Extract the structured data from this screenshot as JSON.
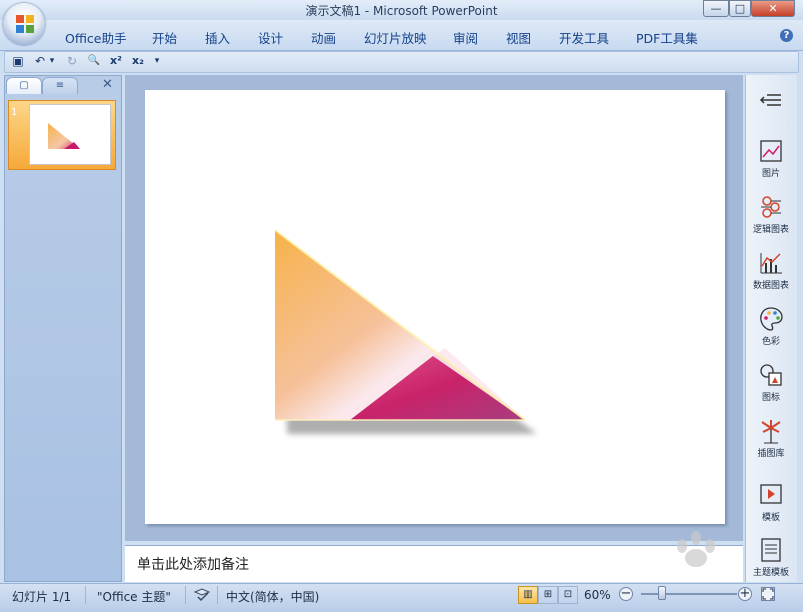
{
  "window": {
    "title": "演示文稿1 - Microsoft PowerPoint",
    "minimize": "—",
    "maximize": "□",
    "close": "✕"
  },
  "office_button": {
    "icon": "office-logo-icon"
  },
  "menu": {
    "items": [
      "Office助手",
      "开始",
      "插入",
      "设计",
      "动画",
      "幻灯片放映",
      "审阅",
      "视图",
      "开发工具",
      "PDF工具集"
    ],
    "help": "?"
  },
  "quick_access": {
    "items": [
      {
        "icon": "save-icon",
        "glyph": "▣"
      },
      {
        "icon": "undo-icon",
        "glyph": "↶"
      },
      {
        "icon": "undo-dropdown-icon",
        "glyph": "▾"
      },
      {
        "icon": "redo-icon",
        "glyph": "↻"
      },
      {
        "icon": "print-preview-icon",
        "glyph": "🔍"
      },
      {
        "icon": "superscript-icon",
        "glyph": "x²"
      },
      {
        "icon": "subscript-icon",
        "glyph": "x₂"
      },
      {
        "icon": "customize-dropdown-icon",
        "glyph": "▾"
      }
    ]
  },
  "left_pane": {
    "tabs": [
      {
        "icon": "slides-tab-icon",
        "glyph": "▢"
      },
      {
        "icon": "outline-tab-icon",
        "glyph": "≡"
      }
    ],
    "close": "✕",
    "thumbnail_number": "1"
  },
  "notes": {
    "placeholder": "单击此处添加备注"
  },
  "right_panel": {
    "collapse_icon": "collapse-icon",
    "items": [
      {
        "label": "图片",
        "icon": "picture-icon"
      },
      {
        "label": "逻辑图表",
        "icon": "logic-chart-icon"
      },
      {
        "label": "数据图表",
        "icon": "data-chart-icon"
      },
      {
        "label": "色彩",
        "icon": "palette-icon"
      },
      {
        "label": "图标",
        "icon": "shapes-icon"
      },
      {
        "label": "插图库",
        "icon": "illustration-icon"
      },
      {
        "label": "模板",
        "icon": "template-icon"
      },
      {
        "label": "主题模板",
        "icon": "theme-template-icon"
      }
    ]
  },
  "status": {
    "slide": "幻灯片 1/1",
    "theme": "\"Office 主题\"",
    "language": "中文(简体，中国)",
    "zoom": "60%",
    "zoom_out": "−",
    "zoom_in": "+"
  },
  "colors": {
    "accent": "#15428b",
    "triangle_orange": "#f7b24a",
    "triangle_magenta": "#d21a66"
  }
}
